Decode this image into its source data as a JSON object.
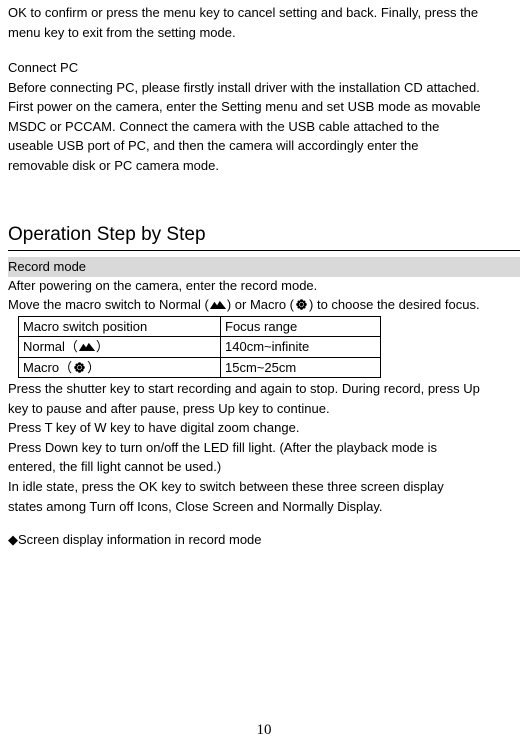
{
  "intro_line1": "OK to confirm or press the menu key to cancel setting and back. Finally, press the",
  "intro_line2": "menu key to exit from the setting mode.",
  "connect_pc": {
    "heading": "Connect PC",
    "l1": "Before connecting PC, please firstly install driver with the installation CD attached.",
    "l2": "First power on the camera, enter the Setting menu and set USB mode as movable",
    "l3": "MSDC or PCCAM. Connect the camera with the USB cable attached to the",
    "l4": "useable USB port of PC, and then the camera will accordingly enter the",
    "l5": "removable disk or PC camera mode."
  },
  "op_heading": "Operation Step by Step",
  "record_mode": {
    "title": "Record mode",
    "l1": "After powering on the camera, enter the record mode.",
    "l2a": "Move the macro switch to Normal (",
    "l2b": ") or Macro (",
    "l2c": ") to choose the desired focus.",
    "table": {
      "h1": "Macro switch position",
      "h2": "Focus range",
      "r1c1a": "Normal（",
      "r1c1b": "）",
      "r1c2": "140cm~infinite",
      "r2c1a": "Macro（",
      "r2c1b": "）",
      "r2c2": "15cm~25cm"
    },
    "p1": "Press the shutter key to start recording and again to stop. During record, press Up",
    "p2": "key to pause and after pause, press Up key to continue.",
    "p3": "Press T key of W key to have digital zoom change.",
    "p4": "Press Down key to turn on/off the LED fill light. (After the playback mode is",
    "p5": "entered, the fill light cannot be used.)",
    "p6": "In idle state, press the OK key to switch between these three screen display",
    "p7": "states among Turn off Icons, Close Screen and Normally Display.",
    "screen_info": "◆Screen display information in record mode"
  },
  "page_number": "10"
}
